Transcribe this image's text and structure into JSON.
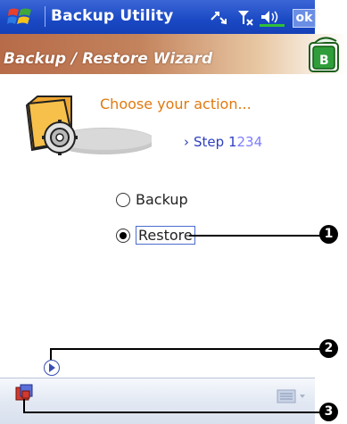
{
  "titlebar": {
    "title": "Backup Utility",
    "ok_label": "ok",
    "status_icons": [
      "connectivity-icon",
      "signal-icon",
      "volume-icon"
    ]
  },
  "wizard": {
    "title": "Backup / Restore Wizard",
    "prompt": "Choose your action...",
    "step_prefix": "Step",
    "current_step": "1",
    "other_steps": [
      "2",
      "3",
      "4"
    ]
  },
  "options": {
    "backup_label": "Backup",
    "restore_label": "Restore",
    "selected": "Restore"
  },
  "callouts": [
    "1",
    "2",
    "3"
  ],
  "colors": {
    "titlebar_blue": "#1a49c4",
    "prompt_orange": "#e07a10",
    "step_blue": "#2d3fbf"
  }
}
